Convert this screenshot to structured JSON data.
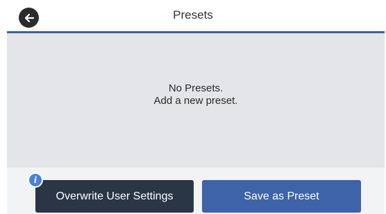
{
  "header": {
    "title": "Presets",
    "back_icon": "back-arrow-icon"
  },
  "content": {
    "message_line1": "No Presets.",
    "message_line2": "Add a new preset."
  },
  "buttons": {
    "overwrite_label": "Overwrite User Settings",
    "save_label": "Save as Preset",
    "info_badge": "i",
    "info_icon": "info-icon"
  },
  "colors": {
    "accent": "#3e63a9",
    "dark_button": "#2a3646",
    "content_bg": "#e4e5e8",
    "info_badge": "#4a82d4"
  }
}
